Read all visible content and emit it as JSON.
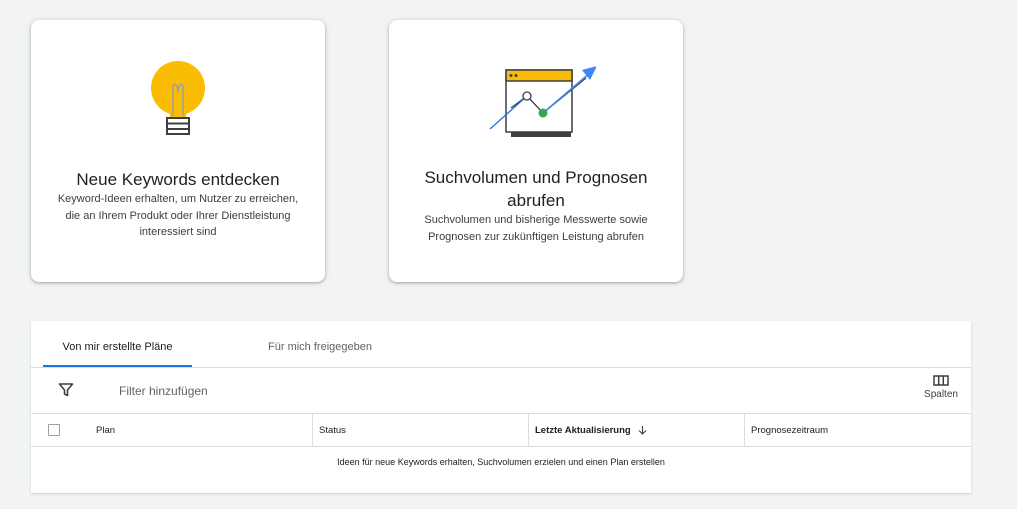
{
  "cards": [
    {
      "title": "Neue Keywords entdecken",
      "description": "Keyword-Ideen erhalten, um Nutzer zu erreichen, die an Ihrem Produkt oder Ihrer Dienstleistung interessiert sind",
      "icon": "lightbulb-icon"
    },
    {
      "title": "Suchvolumen und Prognosen abrufen",
      "description": "Suchvolumen und bisherige Messwerte sowie Prognosen zur zukünftigen Leistung abrufen",
      "icon": "forecast-chart-icon"
    }
  ],
  "plans": {
    "tabs": [
      {
        "label": "Von mir erstellte Pläne",
        "active": true
      },
      {
        "label": "Für mich freigegeben",
        "active": false
      }
    ],
    "filter": {
      "label": "Filter hinzufügen",
      "icon": "filter-icon"
    },
    "columns_button": {
      "label": "Spalten",
      "icon": "columns-icon"
    },
    "columns": [
      "Plan",
      "Status",
      "Letzte Aktualisierung",
      "Prognosezeitraum"
    ],
    "sort_icon": "arrow-down-icon",
    "empty_message": "Ideen für neue Keywords erhalten, Suchvolumen erzielen und einen Plan erstellen"
  },
  "colors": {
    "background": "#f1f3f4",
    "accent_blue": "#1a73e8",
    "bulb_yellow": "#fbbc04",
    "success_green": "#34a853"
  }
}
